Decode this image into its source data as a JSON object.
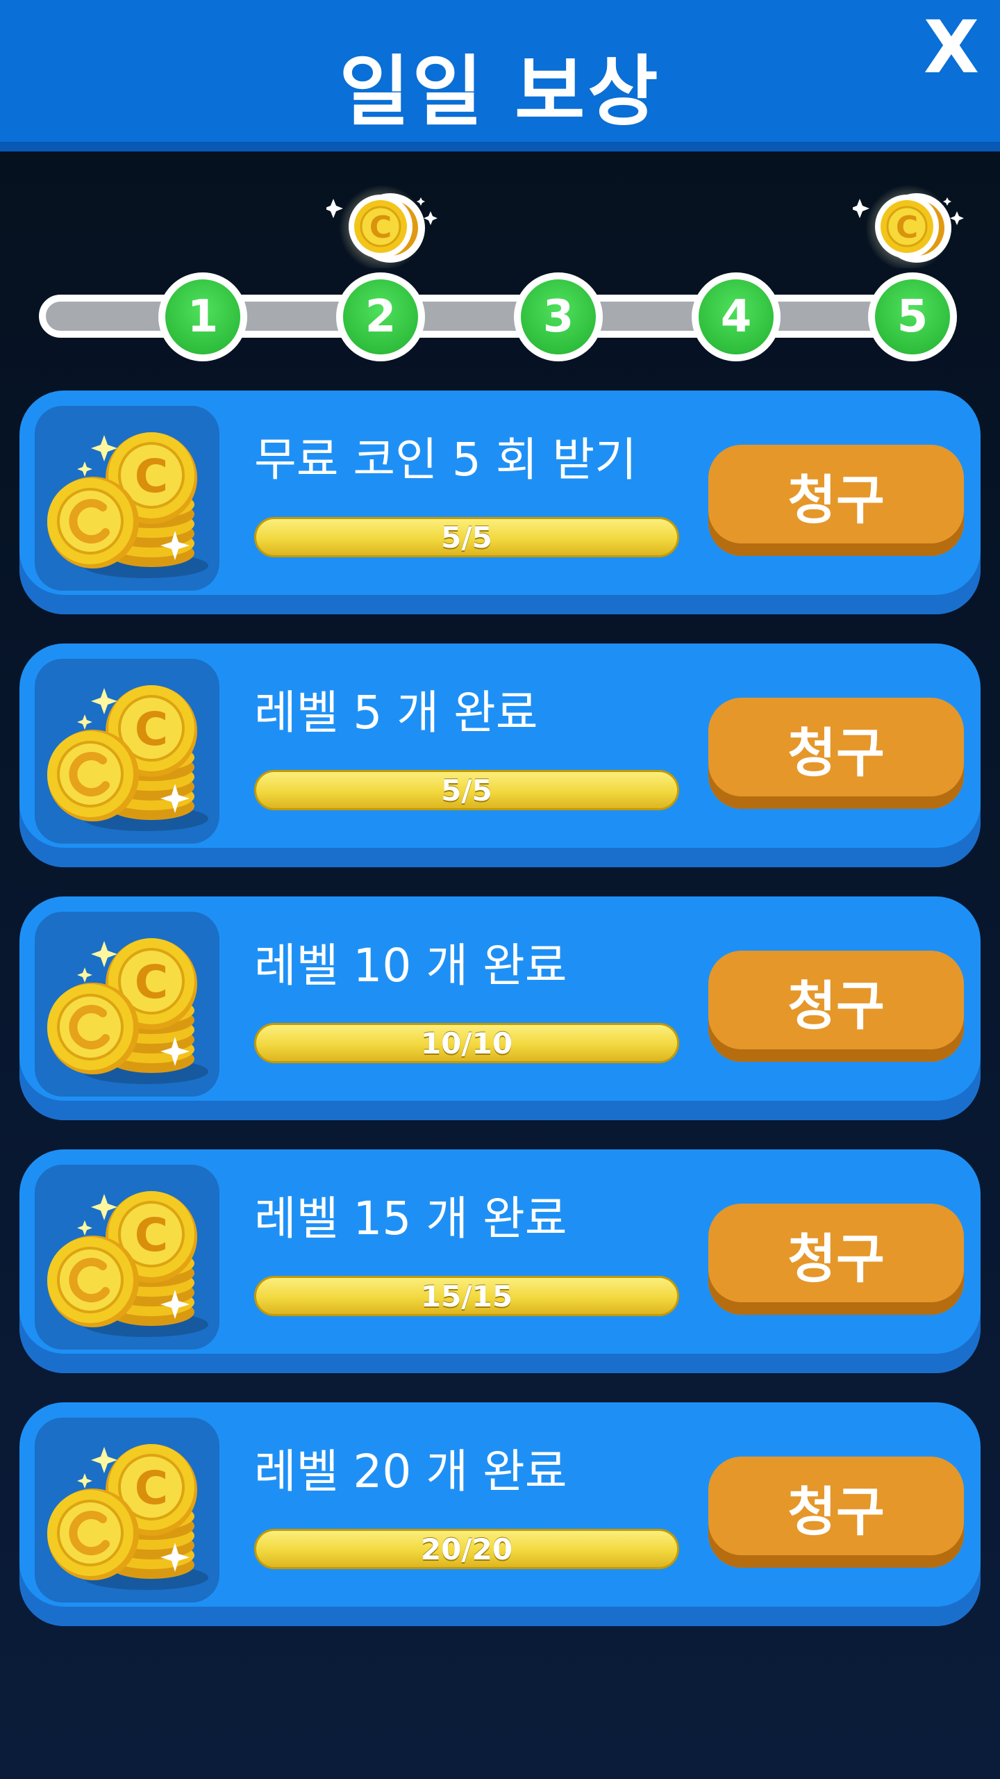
{
  "header": {
    "title": "일일 보상",
    "close_label": "X"
  },
  "milestones": {
    "steps": [
      "1",
      "2",
      "3",
      "4",
      "5"
    ],
    "coin_rewards_at": [
      "2",
      "5"
    ]
  },
  "tasks": [
    {
      "title": "무료 코인 5 회 받기",
      "progress_text": "5/5",
      "progress": 1.0,
      "button_label": "청구"
    },
    {
      "title": "레벨 5 개 완료",
      "progress_text": "5/5",
      "progress": 1.0,
      "button_label": "청구"
    },
    {
      "title": "레벨 10 개 완료",
      "progress_text": "10/10",
      "progress": 1.0,
      "button_label": "청구"
    },
    {
      "title": "레벨 15 개 완료",
      "progress_text": "15/15",
      "progress": 1.0,
      "button_label": "청구"
    },
    {
      "title": "레벨 20 개 완료",
      "progress_text": "20/20",
      "progress": 1.0,
      "button_label": "청구"
    }
  ],
  "colors": {
    "header": "#0a6fd6",
    "card": "#1e90f5",
    "button": "#e5972a",
    "step": "#2fbf3d",
    "progress": "#f0d53a"
  },
  "icons": {
    "close": "close-icon",
    "task": "coin-stack-icon",
    "milestone_reward": "coin-icon"
  }
}
